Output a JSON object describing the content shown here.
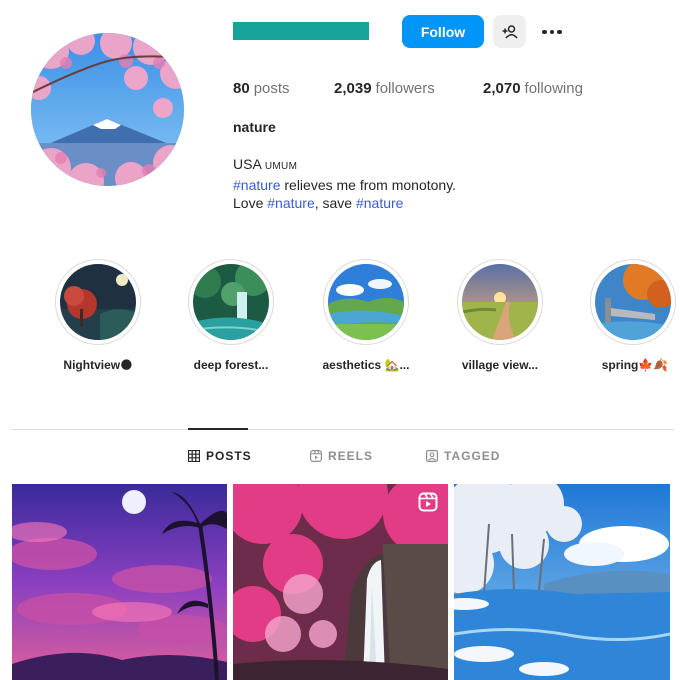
{
  "theme": {
    "brand": "#0095f6",
    "accent_bar": "#16a39a",
    "hashtag": "#3a5bd9",
    "text": "#262626",
    "muted": "#737373"
  },
  "profile": {
    "username_redacted": true,
    "follow_label": "Follow",
    "add_user_icon": "add-user-icon",
    "more_icon": "more-horizontal-icon",
    "avatar_description_icon": "mount-fuji-cherry-blossom-avatar"
  },
  "stats": {
    "posts_count": "80",
    "posts_label": "posts",
    "followers_count": "2,039",
    "followers_label": "followers",
    "following_count": "2,070",
    "following_label": "following"
  },
  "fullname": "nature",
  "bio": {
    "line1_text": "USA",
    "line1_small": "UMUM",
    "line2_tag": "#nature",
    "line2_rest": " relieves me from monotony.",
    "line3_pre": "Love ",
    "line3_tag1": "#nature",
    "line3_mid": ", save ",
    "line3_tag2": "#nature"
  },
  "highlights": [
    {
      "label": "Nightview🌑"
    },
    {
      "label": "deep forest..."
    },
    {
      "label": "aesthetics 🏡..."
    },
    {
      "label": "village view..."
    },
    {
      "label": "spring🍁🍂"
    }
  ],
  "tabs": [
    {
      "label": "POSTS",
      "icon": "grid-icon",
      "active": true
    },
    {
      "label": "REELS",
      "icon": "reels-icon",
      "active": false
    },
    {
      "label": "TAGGED",
      "icon": "tagged-icon",
      "active": false
    }
  ],
  "posts": [
    {
      "icon": "purple-night-sky-moon-palm"
    },
    {
      "icon": "pink-forest-waterfall",
      "reel_badge": "reels-badge-icon"
    },
    {
      "icon": "snowy-trees-blue-lake"
    }
  ]
}
